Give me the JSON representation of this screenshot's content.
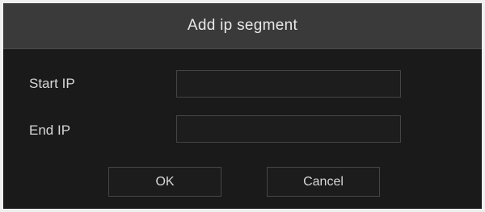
{
  "dialog": {
    "title": "Add ip segment"
  },
  "form": {
    "start_ip": {
      "label": "Start IP",
      "value": ""
    },
    "end_ip": {
      "label": "End IP",
      "value": ""
    }
  },
  "buttons": {
    "ok_label": "OK",
    "cancel_label": "Cancel"
  },
  "colors": {
    "title_bar": "#3a3a3a",
    "dialog_body": "#1a1a1a",
    "frame": "#efefef",
    "text": "#d8d8d8"
  }
}
